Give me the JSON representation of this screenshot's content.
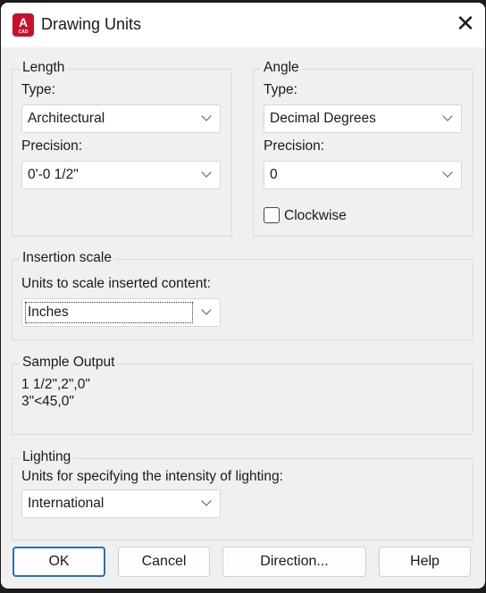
{
  "window": {
    "title": "Drawing Units",
    "app_icon": "autocad-icon",
    "app_icon_letter": "A",
    "app_icon_sub": "CAD"
  },
  "length": {
    "legend": "Length",
    "type_label": "Type:",
    "type_value": "Architectural",
    "precision_label": "Precision:",
    "precision_value": "0'-0 1/2\""
  },
  "angle": {
    "legend": "Angle",
    "type_label": "Type:",
    "type_value": "Decimal Degrees",
    "precision_label": "Precision:",
    "precision_value": "0",
    "clockwise_label": "Clockwise",
    "clockwise_checked": false
  },
  "insertion": {
    "legend": "Insertion scale",
    "label": "Units to scale inserted content:",
    "value": "Inches"
  },
  "sample": {
    "legend": "Sample Output",
    "lines": [
      "1 1/2\",2\",0\"",
      "3\"<45,0\""
    ]
  },
  "lighting": {
    "legend": "Lighting",
    "label": "Units for specifying the intensity of lighting:",
    "value": "International"
  },
  "buttons": {
    "ok": "OK",
    "cancel": "Cancel",
    "direction": "Direction...",
    "help": "Help"
  },
  "colors": {
    "accent": "#2a6fb8",
    "app_icon": "#c8102e"
  }
}
